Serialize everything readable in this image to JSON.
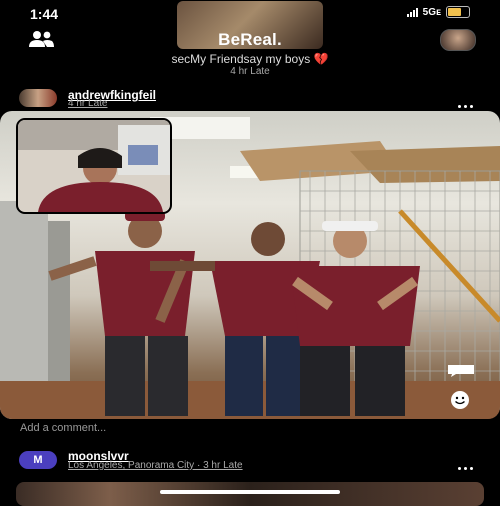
{
  "status_bar": {
    "time": "1:44",
    "network": "5Gᴇ",
    "battery_level": 0.6
  },
  "header": {
    "logo": "BeReal.",
    "caption": "secMy Friendsay my boys",
    "heart": "💔",
    "late": "4 hr Late"
  },
  "post1": {
    "username": "andrewfkingfeil",
    "meta": "4 hr Late",
    "add_comment": "Add a comment..."
  },
  "post2": {
    "avatar_initial": "M",
    "username": "moonslvvr",
    "meta": "Los Angeles, Panorama City · 3 hr Late"
  },
  "colors": {
    "accent_heart": "#e3342f",
    "post2_avatar": "#4b3fbf",
    "shirt": "#7a1f2c"
  }
}
